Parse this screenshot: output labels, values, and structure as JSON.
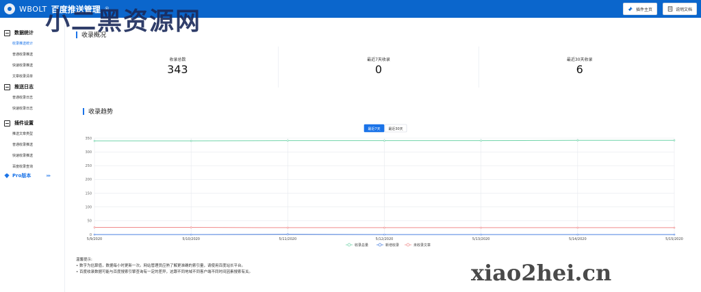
{
  "header": {
    "brand_text": "WBOLT",
    "title": "百度推送管理",
    "title_suffix": "®",
    "actions": [
      {
        "label": "插件主页",
        "icon": "bird-icon"
      },
      {
        "label": "说明文档",
        "icon": "document-icon"
      }
    ]
  },
  "sidebar": {
    "groups": [
      {
        "title": "数据统计",
        "icon": "chart-icon",
        "items": [
          {
            "label": "收录推送统计",
            "active": true
          },
          {
            "label": "普通收录推送"
          },
          {
            "label": "快速收录推送"
          },
          {
            "label": "文章收录清单"
          }
        ]
      },
      {
        "title": "推送日志",
        "icon": "log-icon",
        "items": [
          {
            "label": "普通收录日志"
          },
          {
            "label": "快速收录日志"
          }
        ]
      },
      {
        "title": "插件设置",
        "icon": "settings-icon",
        "items": [
          {
            "label": "推送文章类型"
          },
          {
            "label": "普通收录推送"
          },
          {
            "label": "快速收录推送"
          },
          {
            "label": "百度收录查询"
          }
        ]
      }
    ],
    "pro": {
      "label": "Pro版本",
      "chevrons": "›››"
    }
  },
  "overview": {
    "title": "收录概况",
    "kpis": [
      {
        "label": "收录总数",
        "value": "343"
      },
      {
        "label": "最近7天收录",
        "value": "0"
      },
      {
        "label": "最近30天收录",
        "value": "6"
      }
    ]
  },
  "trend": {
    "title": "收录趋势",
    "tabs": [
      {
        "label": "最近7天",
        "active": true
      },
      {
        "label": "最近30天",
        "active": false
      }
    ]
  },
  "chart_data": {
    "type": "line",
    "title": "",
    "xlabel": "",
    "ylabel": "",
    "x": [
      "5/9/2020",
      "5/10/2020",
      "5/11/2020",
      "5/12/2020",
      "5/13/2020",
      "5/14/2020",
      "5/15/2020"
    ],
    "ylim": [
      0,
      350
    ],
    "yticks": [
      0,
      50,
      100,
      150,
      200,
      250,
      300,
      350
    ],
    "grid": true,
    "legend": "bottom",
    "series": [
      {
        "name": "收录总量",
        "color": "#6fd3a8",
        "values": [
          340,
          340,
          341,
          341,
          341,
          342,
          342
        ]
      },
      {
        "name": "新增收录",
        "color": "#4a7fe0",
        "values": [
          0,
          0,
          1,
          0,
          0,
          0,
          0
        ]
      },
      {
        "name": "未收录文章",
        "color": "#f08a8a",
        "values": [
          26,
          26,
          25,
          25,
          25,
          25,
          25
        ]
      }
    ]
  },
  "notes": {
    "heading": "温馨提示:",
    "lines": [
      "• 数字为估算值，数据每小时更新一次。网站管理员应熟了解更准确的索引量，请使用百度站长平台。",
      "• 百度收录数据可能与百度搜索引擎查询有一定的差异，这跟不同地域不同客户端不同时间因素搜索有关。"
    ]
  },
  "watermarks": {
    "top": "小二黑资源网",
    "bottom": "xiao2hei.cn"
  }
}
